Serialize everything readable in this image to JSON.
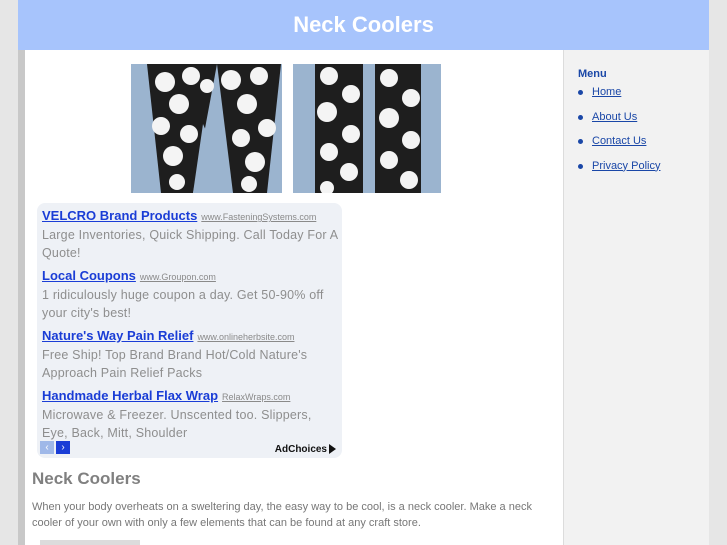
{
  "header": {
    "title": "Neck Coolers"
  },
  "sidebar": {
    "title": "Menu",
    "items": [
      {
        "label": "Home"
      },
      {
        "label": "About Us"
      },
      {
        "label": "Contact Us"
      },
      {
        "label": "Privacy Policy"
      }
    ]
  },
  "images": [
    {
      "name": "neck-cooler-photo-1"
    },
    {
      "name": "neck-cooler-photo-2"
    }
  ],
  "ads": {
    "items": [
      {
        "title": "VELCRO Brand Products",
        "url": "www.FasteningSystems.com",
        "desc": "Large Inventories, Quick Shipping. Call Today For A Quote!"
      },
      {
        "title": "Local Coupons",
        "url": "www.Groupon.com",
        "desc": "1 ridiculously huge coupon a day. Get 50-90% off your city's best!"
      },
      {
        "title": "Nature's Way Pain Relief",
        "url": "www.onlineherbsite.com",
        "desc": "Free Ship! Top Brand Brand Hot/Cold Nature's Approach Pain Relief Packs"
      },
      {
        "title": "Handmade Herbal Flax Wrap",
        "url": "RelaxWraps.com",
        "desc": "Microwave & Freezer. Unscented too. Slippers, Eye, Back, Mitt, Shoulder"
      }
    ],
    "adchoices": "AdChoices"
  },
  "content": {
    "title": "Neck Coolers",
    "text": "When your body overheats on a sweltering day, the easy way to be cool, is a neck cooler. Make a neck cooler of your own with only a few elements that can be found at any craft store."
  }
}
